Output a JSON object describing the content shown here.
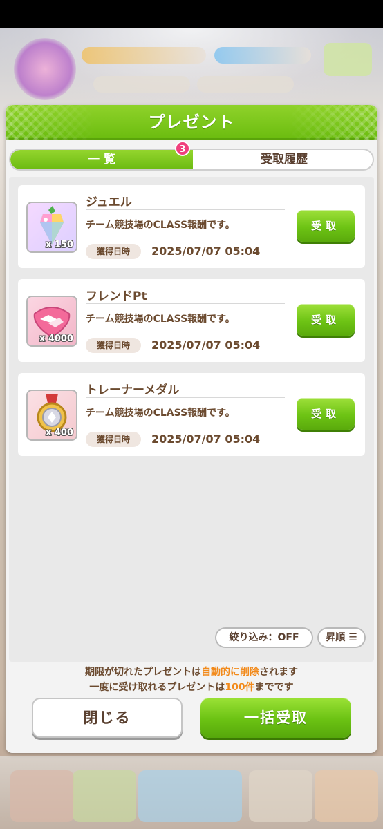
{
  "modal": {
    "title": "プレゼント",
    "tabs": [
      {
        "label": "一 覧",
        "active": true,
        "badge": "3"
      },
      {
        "label": "受取履歴",
        "active": false
      }
    ]
  },
  "presents": [
    {
      "name": "ジュエル",
      "quantity": "x 150",
      "description": "チーム競技場のCLASS報酬です。",
      "date_label": "獲得日時",
      "date": "2025/07/07 05:04",
      "button": "受取",
      "icon": "jewel-icon"
    },
    {
      "name": "フレンドPt",
      "quantity": "x 4000",
      "description": "チーム競技場のCLASS報酬です。",
      "date_label": "獲得日時",
      "date": "2025/07/07 05:04",
      "button": "受取",
      "icon": "handshake-icon"
    },
    {
      "name": "トレーナーメダル",
      "quantity": "x 400",
      "description": "チーム競技場のCLASS報酬です。",
      "date_label": "獲得日時",
      "date": "2025/07/07 05:04",
      "button": "受取",
      "icon": "medal-icon"
    }
  ],
  "controls": {
    "filter": "絞り込み：OFF",
    "sort": "昇順"
  },
  "notices": {
    "line1": {
      "pre": "期限が切れたプレゼントは",
      "highlight": "自動的に削除",
      "post": "されます"
    },
    "line2": {
      "pre": "一度に受け取れるプレゼントは",
      "highlight": "100件",
      "post": "までです"
    }
  },
  "footer": {
    "close": "閉じる",
    "receive_all": "一括受取"
  },
  "colors": {
    "accent_green": "#6cbd10",
    "text_brown": "#6b4a2f",
    "highlight_orange": "#f28a1b",
    "badge_pink": "#f03f7e"
  }
}
